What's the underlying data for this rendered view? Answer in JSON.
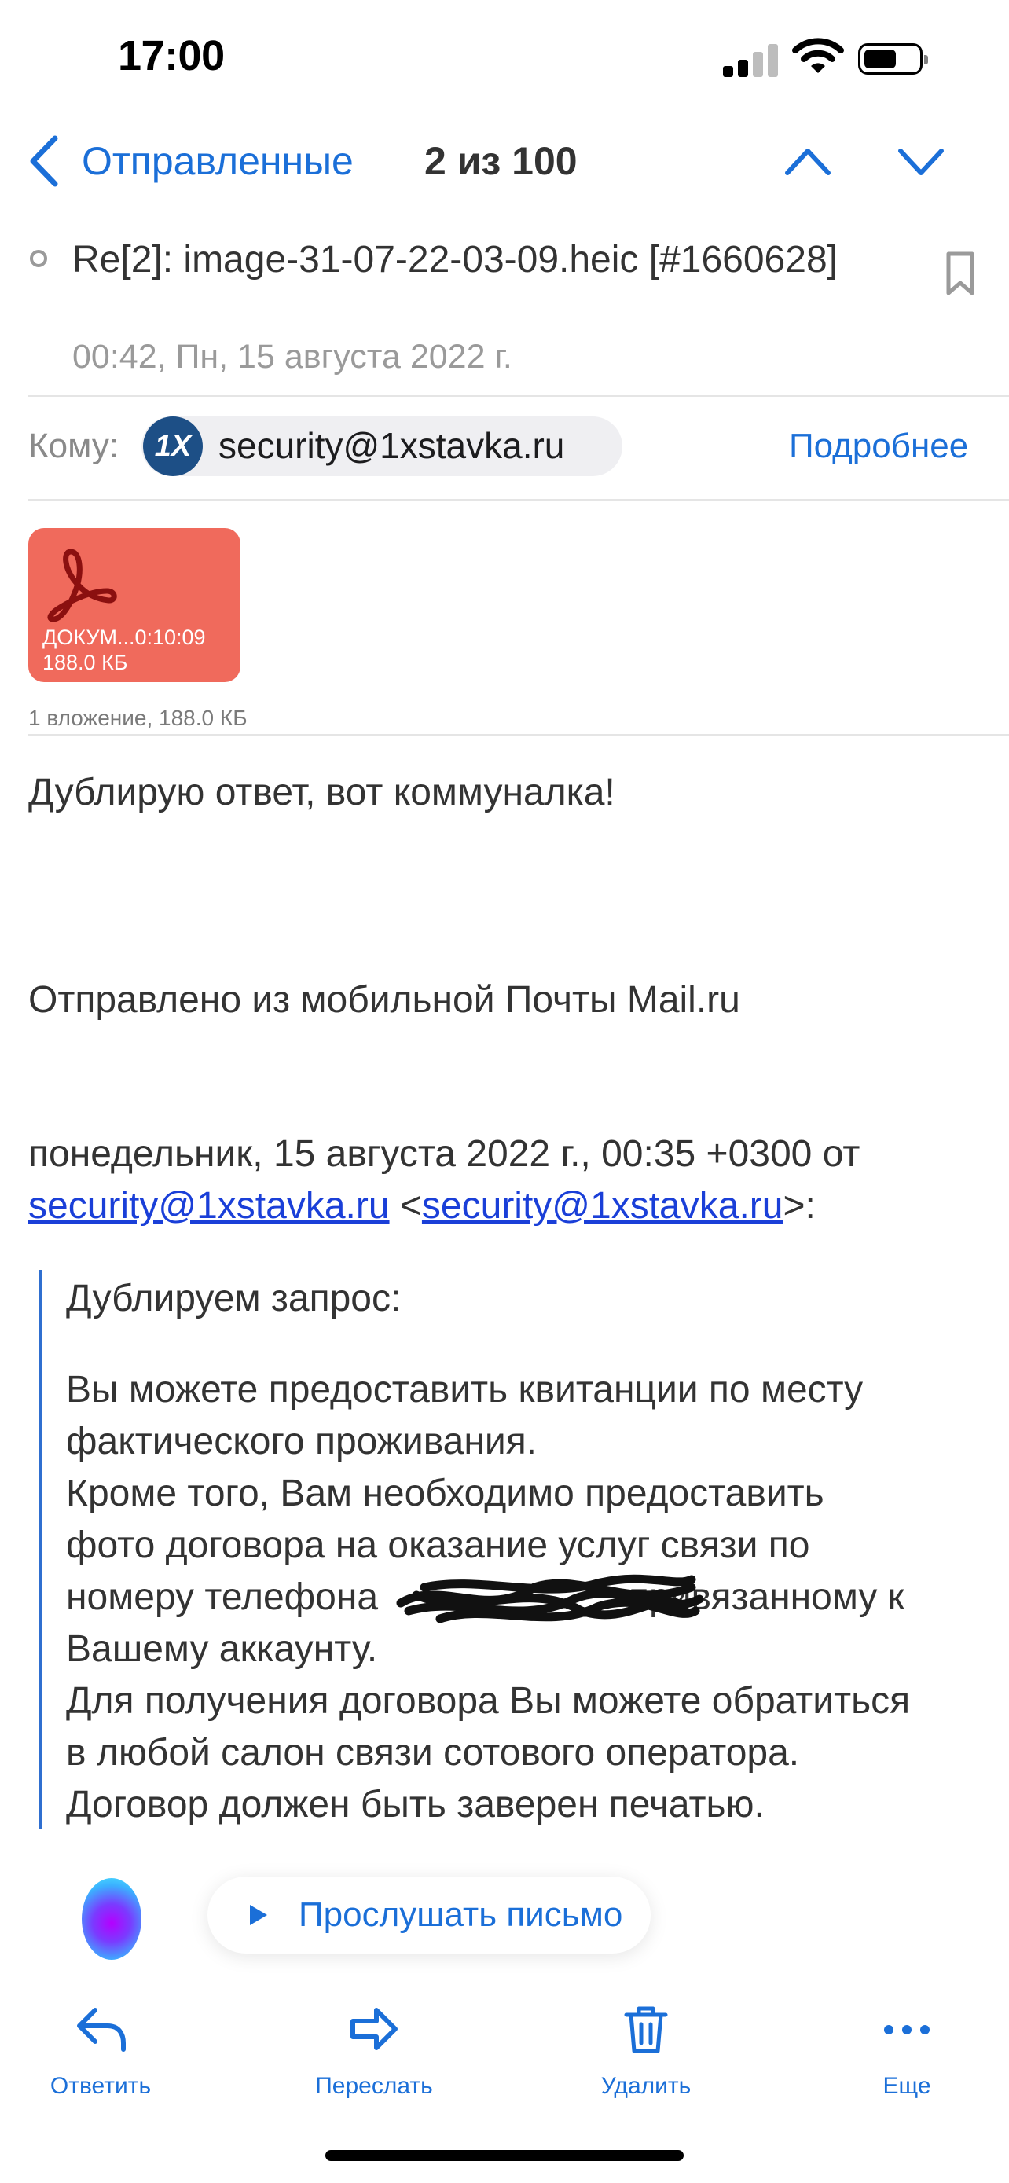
{
  "status_bar": {
    "time": "17:00"
  },
  "nav": {
    "back_label": "Отправленные",
    "counter": "2 из 100"
  },
  "message": {
    "subject": "Re[2]: image-31-07-22-03-09.heic [#1660628]",
    "date": "00:42, Пн, 15 августа 2022 г."
  },
  "recipient": {
    "to_label": "Кому:",
    "avatar_text": "1X",
    "email": "security@1xstavka.ru",
    "details_label": "Подробнее"
  },
  "attachment": {
    "name": "ДОКУМ...0:10:09",
    "size": "188.0 КБ",
    "summary": "1 вложение, 188.0 КБ",
    "color": "#f06a5c"
  },
  "body": {
    "line1": "Дублирую ответ, вот коммуналка!",
    "signature": "Отправлено из мобильной Почты Mail.ru",
    "quote_header": "понедельник, 15 августа 2022 г., 00:35 +0300 от",
    "quote_email": "security@1xstavka.ru",
    "quote_lt": " <",
    "quote_gt": ">:",
    "quoted": {
      "p1": "Дублируем запрос:",
      "p2_l1": "Вы можете предоставить квитанции по месту",
      "p2_l2": "фактического проживания.",
      "p2_l3": "Кроме того, Вам необходимо предоставить",
      "p2_l4": "фото договора на оказание услуг связи по",
      "p2_l5a": "номеру телефона",
      "p2_l5b": "привязанному к",
      "p2_l6": "Вашему аккаунту.",
      "p2_l7": "Для получения договора Вы можете обратиться",
      "p2_l8": "в любой салон связи сотового оператора.",
      "p2_l9": "Договор должен быть заверен печатью."
    }
  },
  "listen_button": {
    "label": "Прослушать письмо"
  },
  "toolbar": {
    "reply": "Ответить",
    "forward": "Переслать",
    "delete": "Удалить",
    "more": "Еще"
  },
  "colors": {
    "accent": "#1b6fd8",
    "link": "#1a3fd8",
    "quote_bar": "#2f6fd0"
  }
}
